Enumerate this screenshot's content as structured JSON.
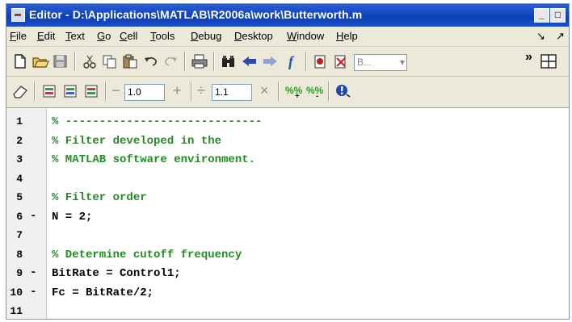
{
  "window": {
    "title": "Editor - D:\\Applications\\MATLAB\\R2006a\\work\\Butterworth.m",
    "min_label": "_",
    "max_label": "□"
  },
  "menu": [
    {
      "key": "file",
      "label": "File"
    },
    {
      "key": "edit",
      "label": "Edit"
    },
    {
      "key": "text",
      "label": "Text"
    },
    {
      "key": "go",
      "label": "Go"
    },
    {
      "key": "cell",
      "label": "Cell"
    },
    {
      "key": "tools",
      "label": "Tools"
    },
    {
      "key": "debug",
      "label": "Debug"
    },
    {
      "key": "desktop",
      "label": "Desktop"
    },
    {
      "key": "window",
      "label": "Window"
    },
    {
      "key": "help",
      "label": "Help"
    }
  ],
  "menu_right": [
    "↘",
    "↗"
  ],
  "toolbar1": {
    "stack_value": "B...",
    "overflow_label": "»",
    "function_label": "f"
  },
  "toolbar2": {
    "minus_label": "−",
    "value1": "1.0",
    "plus_label": "+",
    "divide_label": "÷",
    "value2": "1.1",
    "times_label": "×"
  },
  "code_lines": [
    {
      "num": "1",
      "dash": "",
      "type": "comment",
      "text": "% -----------------------------"
    },
    {
      "num": "2",
      "dash": "",
      "type": "comment",
      "text": "% Filter developed in the"
    },
    {
      "num": "3",
      "dash": "",
      "type": "comment",
      "text": "% MATLAB software environment."
    },
    {
      "num": "4",
      "dash": "",
      "type": "blank",
      "text": ""
    },
    {
      "num": "5",
      "dash": "",
      "type": "comment",
      "text": "% Filter order"
    },
    {
      "num": "6",
      "dash": "-",
      "type": "stmt",
      "text": "N = 2;"
    },
    {
      "num": "7",
      "dash": "",
      "type": "blank",
      "text": ""
    },
    {
      "num": "8",
      "dash": "",
      "type": "comment",
      "text": "% Determine cutoff frequency"
    },
    {
      "num": "9",
      "dash": "-",
      "type": "stmt",
      "text": "BitRate = Control1;"
    },
    {
      "num": "10",
      "dash": "-",
      "type": "stmt",
      "text": "Fc = BitRate/2;"
    },
    {
      "num": "11",
      "dash": "",
      "type": "blank",
      "text": ""
    }
  ],
  "colors": {
    "comment": "#228b22",
    "title_bar": "#0b3fb8"
  }
}
